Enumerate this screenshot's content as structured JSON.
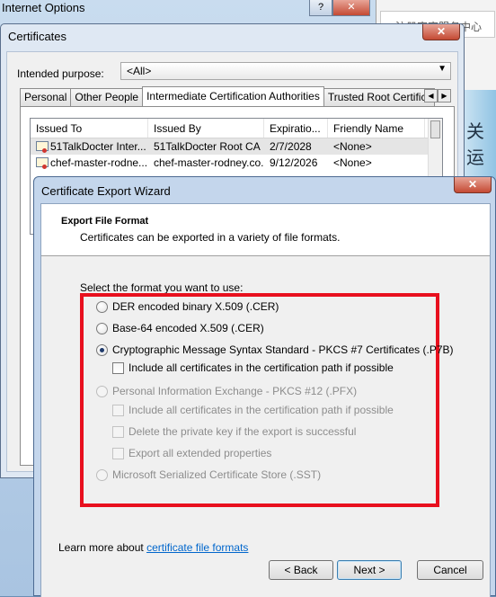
{
  "internet_options": {
    "title": "Internet Options",
    "right_tab_text": "注册官官服务中心",
    "right_strip_text": "关 运"
  },
  "certificates": {
    "title": "Certificates",
    "purpose_label": "Intended purpose:",
    "purpose_value": "<All>",
    "tabs": [
      {
        "label": "Personal"
      },
      {
        "label": "Other People"
      },
      {
        "label": "Intermediate Certification Authorities"
      },
      {
        "label": "Trusted Root Certification"
      }
    ],
    "columns": [
      "Issued To",
      "Issued By",
      "Expiratio...",
      "Friendly Name"
    ],
    "rows": [
      {
        "issued_to": "51TalkDocter Inter...",
        "issued_by": "51TalkDocter Root CA",
        "expires": "2/7/2028",
        "friendly": "<None>"
      },
      {
        "issued_to": "chef-master-rodne...",
        "issued_by": "chef-master-rodney.co...",
        "expires": "9/12/2026",
        "friendly": "<None>"
      }
    ]
  },
  "wizard": {
    "title": "Certificate Export Wizard",
    "header_title": "Export File Format",
    "header_subtitle": "Certificates can be exported in a variety of file formats.",
    "select_label": "Select the format you want to use:",
    "options": {
      "der": "DER encoded binary X.509 (.CER)",
      "base64": "Base-64 encoded X.509 (.CER)",
      "pkcs7": "Cryptographic Message Syntax Standard - PKCS #7 Certificates (.P7B)",
      "pkcs7_include": "Include all certificates in the certification path if possible",
      "pfx": "Personal Information Exchange - PKCS #12 (.PFX)",
      "pfx_include": "Include all certificates in the certification path if possible",
      "pfx_delete": "Delete the private key if the export is successful",
      "pfx_extended": "Export all extended properties",
      "sst": "Microsoft Serialized Certificate Store (.SST)"
    },
    "learn_prefix": "Learn more about ",
    "learn_link": "certificate file formats",
    "buttons": {
      "back": "< Back",
      "next": "Next >",
      "cancel": "Cancel"
    }
  },
  "colors": {
    "highlight_box": "#e8101e",
    "link": "#0066cc"
  }
}
